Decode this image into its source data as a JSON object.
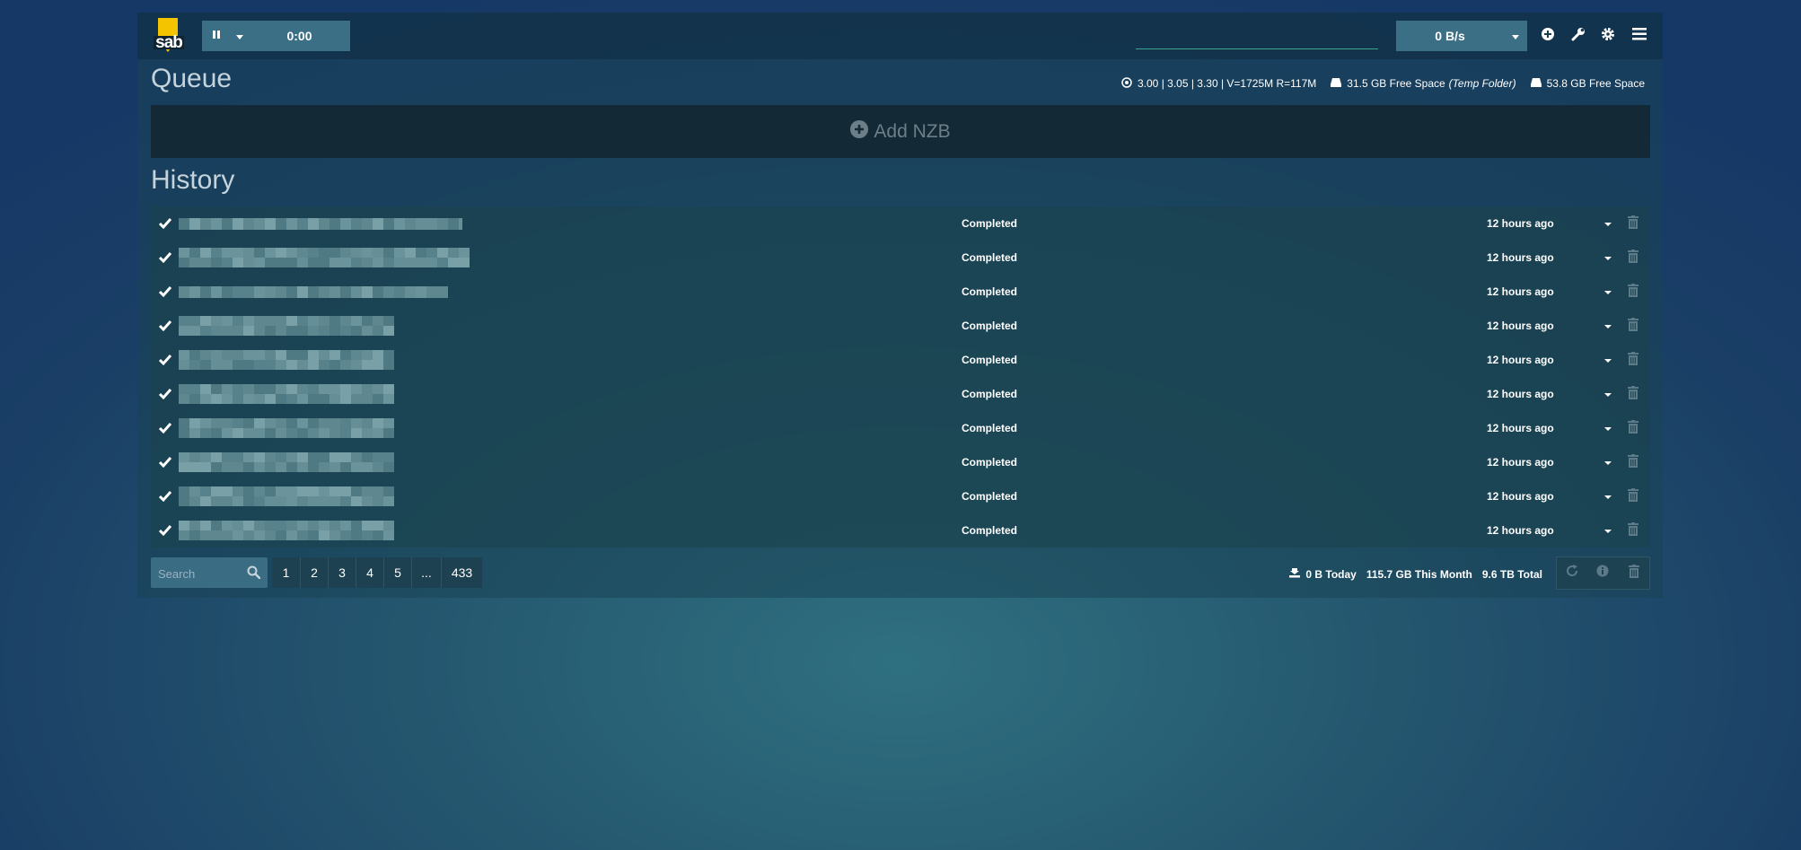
{
  "navbar": {
    "logo_text": "sab",
    "timer": "0:00",
    "speed": "0 B/s",
    "search_placeholder": ""
  },
  "queue": {
    "title": "Queue",
    "status": {
      "load": "3.00 | 3.05 | 3.30 | V=1725M R=117M",
      "temp_free": "31.5 GB Free Space",
      "temp_label": "(Temp Folder)",
      "complete_free": "53.8 GB Free Space"
    },
    "add_nzb_label": "Add NZB"
  },
  "history": {
    "title": "History",
    "rows": [
      {
        "status": "Completed",
        "time": "12 hours ago"
      },
      {
        "status": "Completed",
        "time": "12 hours ago"
      },
      {
        "status": "Completed",
        "time": "12 hours ago"
      },
      {
        "status": "Completed",
        "time": "12 hours ago"
      },
      {
        "status": "Completed",
        "time": "12 hours ago"
      },
      {
        "status": "Completed",
        "time": "12 hours ago"
      },
      {
        "status": "Completed",
        "time": "12 hours ago"
      },
      {
        "status": "Completed",
        "time": "12 hours ago"
      },
      {
        "status": "Completed",
        "time": "12 hours ago"
      },
      {
        "status": "Completed",
        "time": "12 hours ago"
      }
    ]
  },
  "footer": {
    "search_placeholder": "Search",
    "pages": [
      "1",
      "2",
      "3",
      "4",
      "5",
      "...",
      "433"
    ],
    "today": "0 B Today",
    "month": "115.7 GB This Month",
    "total": "9.6 TB Total"
  },
  "icons": {
    "pause": "pause-icon",
    "caret": "caret-down-icon",
    "add": "plus-circle-icon",
    "config": "wrench-icon",
    "settings": "gear-icon",
    "menu": "hamburger-icon",
    "check": "check-icon",
    "trash": "trash-icon",
    "download": "download-icon",
    "refresh": "refresh-icon",
    "info": "info-icon",
    "disk": "hdd-icon",
    "load": "dashboard-icon"
  },
  "colors": {
    "accent": "#3b6f86",
    "logo_yellow": "#f5c400"
  }
}
